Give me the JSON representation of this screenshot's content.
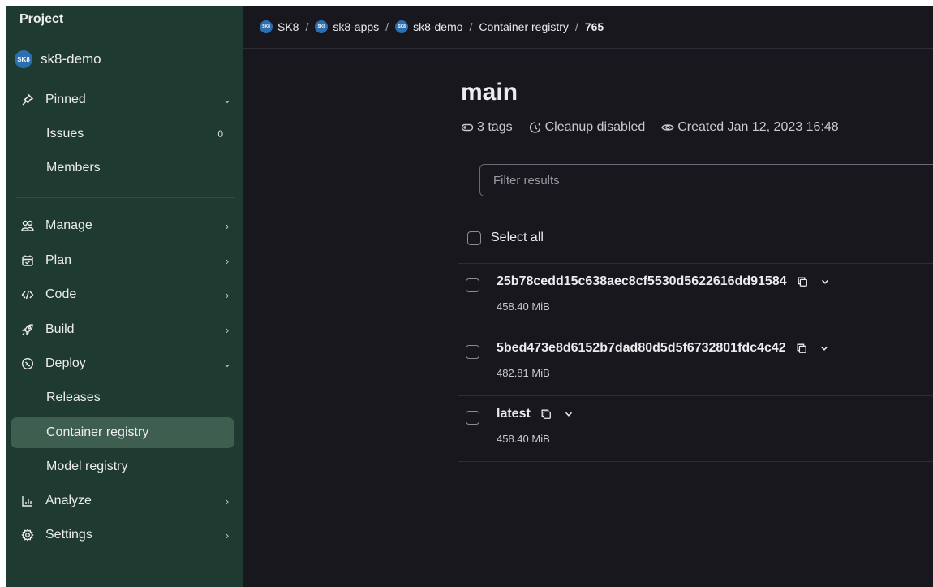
{
  "sidebar": {
    "header": "Project",
    "project_avatar": "SK8",
    "project_name": "sk8-demo",
    "pinned": {
      "label": "Pinned"
    },
    "issues": {
      "label": "Issues",
      "count": "0"
    },
    "members": {
      "label": "Members"
    },
    "manage": {
      "label": "Manage"
    },
    "plan": {
      "label": "Plan"
    },
    "code": {
      "label": "Code"
    },
    "build": {
      "label": "Build"
    },
    "deploy": {
      "label": "Deploy"
    },
    "releases": {
      "label": "Releases"
    },
    "container_registry": {
      "label": "Container registry"
    },
    "model_registry": {
      "label": "Model registry"
    },
    "analyze": {
      "label": "Analyze"
    },
    "settings": {
      "label": "Settings"
    }
  },
  "breadcrumb": {
    "items": [
      {
        "label": "SK8",
        "icon": "SK8"
      },
      {
        "label": "sk8-apps",
        "icon": "SK8"
      },
      {
        "label": "sk8-demo",
        "icon": "SK8"
      },
      {
        "label": "Container registry"
      },
      {
        "label": "765"
      }
    ],
    "separator": "/"
  },
  "main": {
    "title": "main",
    "tags_count": "3 tags",
    "cleanup": "Cleanup disabled",
    "created": "Created Jan 12, 2023 16:48",
    "filter_placeholder": "Filter results",
    "select_all": "Select all",
    "tags": [
      {
        "name": "25b78cedd15c638aec8cf5530d5622616dd91584",
        "size": "458.40 MiB"
      },
      {
        "name": "5bed473e8d6152b7dad80d5d5f6732801fdc4c42",
        "size": "482.81 MiB"
      },
      {
        "name": "latest",
        "size": "458.40 MiB"
      }
    ]
  },
  "colors": {
    "sidebar_bg": "#1f3a30",
    "active_item_bg": "#3e5e50",
    "main_bg": "#18171d",
    "text": "#ececef"
  }
}
